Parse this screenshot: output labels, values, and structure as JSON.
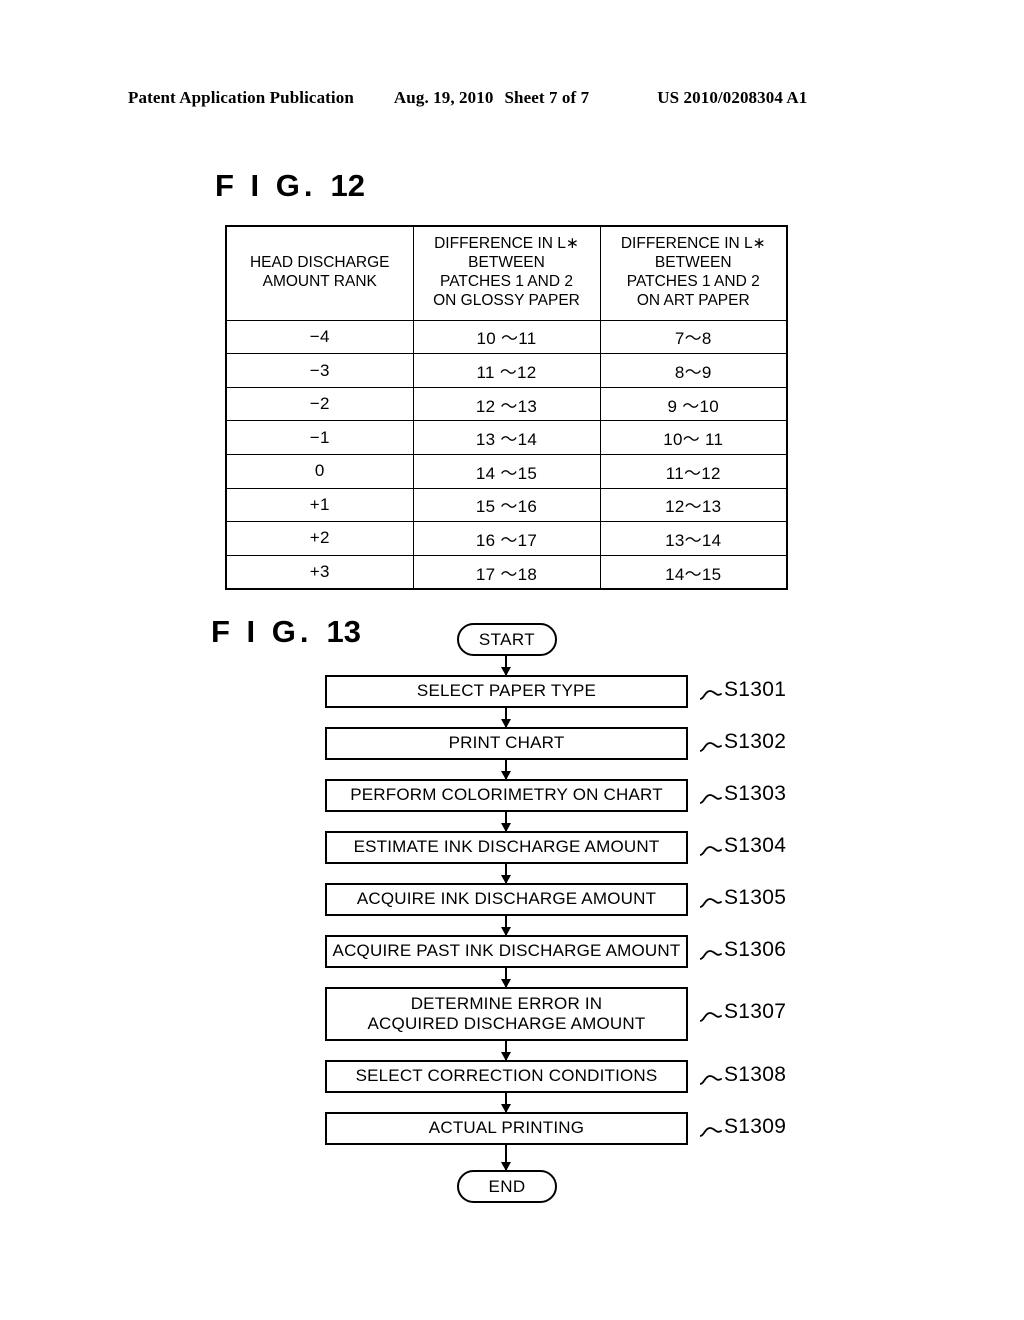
{
  "header": {
    "publication": "Patent Application Publication",
    "date": "Aug. 19, 2010",
    "sheet": "Sheet 7 of 7",
    "number": "US 2010/0208304 A1"
  },
  "fig12": {
    "label_word": "F I G.",
    "label_number": "12",
    "table": {
      "columns": [
        {
          "lines": [
            "HEAD DISCHARGE",
            "AMOUNT RANK"
          ]
        },
        {
          "lines": [
            "DIFFERENCE IN L∗",
            "BETWEEN",
            "PATCHES 1 AND 2",
            "ON GLOSSY PAPER"
          ]
        },
        {
          "lines": [
            "DIFFERENCE IN L∗",
            "BETWEEN",
            "PATCHES 1 AND 2",
            "ON ART PAPER"
          ]
        }
      ],
      "headers": [
        "HEAD DISCHARGE AMOUNT RANK",
        "DIFFERENCE IN L∗ BETWEEN PATCHES 1 AND 2 ON GLOSSY PAPER",
        "DIFFERENCE IN L∗ BETWEEN PATCHES 1 AND 2 ON ART PAPER"
      ],
      "rows": [
        {
          "rank": "−4",
          "glossy": "10 ～11",
          "art": "7～8"
        },
        {
          "rank": "−3",
          "glossy": "11 ～12",
          "art": "8～9"
        },
        {
          "rank": "−2",
          "glossy": "12 ～13",
          "art": "9 ～10"
        },
        {
          "rank": "−1",
          "glossy": "13 ～14",
          "art": "10～ 11"
        },
        {
          "rank": "0",
          "glossy": "14 ～15",
          "art": "11～12"
        },
        {
          "rank": "+1",
          "glossy": "15 ～16",
          "art": "12～13"
        },
        {
          "rank": "+2",
          "glossy": "16 ～17",
          "art": "13～14"
        },
        {
          "rank": "+3",
          "glossy": "17 ～18",
          "art": "14～15"
        }
      ]
    }
  },
  "fig13": {
    "label_word": "F I G.",
    "label_number": "13",
    "start_label": "START",
    "end_label": "END",
    "steps": [
      {
        "text": "SELECT PAPER TYPE",
        "tag": "S1301",
        "lines": 1
      },
      {
        "text": "PRINT CHART",
        "tag": "S1302",
        "lines": 1
      },
      {
        "text": "PERFORM COLORIMETRY ON CHART",
        "tag": "S1303",
        "lines": 1
      },
      {
        "text": "ESTIMATE INK DISCHARGE AMOUNT",
        "tag": "S1304",
        "lines": 1
      },
      {
        "text": "ACQUIRE INK DISCHARGE AMOUNT",
        "tag": "S1305",
        "lines": 1
      },
      {
        "text": "ACQUIRE PAST INK DISCHARGE AMOUNT",
        "tag": "S1306",
        "lines": 1
      },
      {
        "text_line1": "DETERMINE ERROR IN",
        "text_line2": "ACQUIRED DISCHARGE AMOUNT",
        "tag": "S1307",
        "lines": 2
      },
      {
        "text": "SELECT CORRECTION CONDITIONS",
        "tag": "S1308",
        "lines": 1
      },
      {
        "text": "ACTUAL PRINTING",
        "tag": "S1309",
        "lines": 1
      }
    ]
  },
  "colors": {
    "ink": "#000000",
    "paper": "#ffffff"
  }
}
